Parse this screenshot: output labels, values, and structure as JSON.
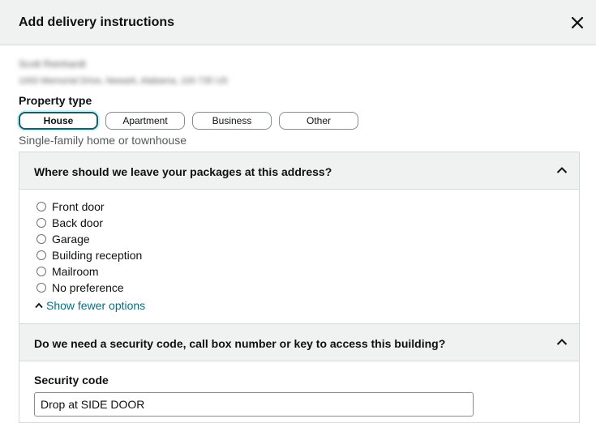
{
  "dialog": {
    "title": "Add delivery instructions"
  },
  "address": {
    "name": "Scott Reinhardt",
    "line": "1000 Memorial Drive, Newark, Alabama, 100 735 US"
  },
  "property": {
    "label": "Property type",
    "options": [
      "House",
      "Apartment",
      "Business",
      "Other"
    ],
    "selected": "House",
    "hint": "Single-family home or townhouse"
  },
  "packages": {
    "question": "Where should we leave your packages at this address?",
    "options": [
      "Front door",
      "Back door",
      "Garage",
      "Building reception",
      "Mailroom",
      "No preference"
    ],
    "show_fewer": "Show fewer options"
  },
  "security": {
    "question": "Do we need a security code, call box number or key to access this building?",
    "field_label": "Security code",
    "value": "Drop at SIDE DOOR"
  }
}
